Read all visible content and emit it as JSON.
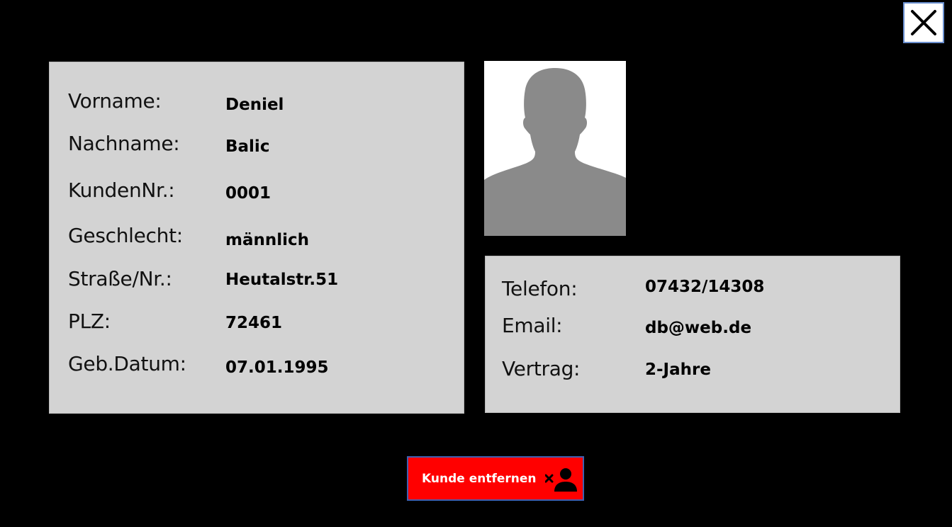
{
  "customer": {
    "fields": [
      {
        "label": "Vorname:",
        "value": "Deniel"
      },
      {
        "label": "Nachname:",
        "value": "Balic"
      },
      {
        "label": "KundenNr.:",
        "value": "0001"
      },
      {
        "label": "Geschlecht:",
        "value": "männlich"
      },
      {
        "label": "Straße/Nr.:",
        "value": "Heutalstr.51"
      },
      {
        "label": "PLZ:",
        "value": "72461"
      },
      {
        "label": "Geb.Datum:",
        "value": "07.01.1995"
      }
    ]
  },
  "contact": {
    "fields": [
      {
        "label": "Telefon:",
        "value": "07432/14308"
      },
      {
        "label": "Email:",
        "value": "db@web.de"
      },
      {
        "label": "Vertrag:",
        "value": "2-Jahre"
      }
    ]
  },
  "actions": {
    "remove_label": "Kunde entfernen"
  },
  "icons": {
    "close": "close-icon",
    "avatar": "person-silhouette-icon",
    "remove": "remove-user-icon"
  },
  "colors": {
    "background": "#000000",
    "panel": "#d3d3d3",
    "danger": "#ff0000"
  }
}
